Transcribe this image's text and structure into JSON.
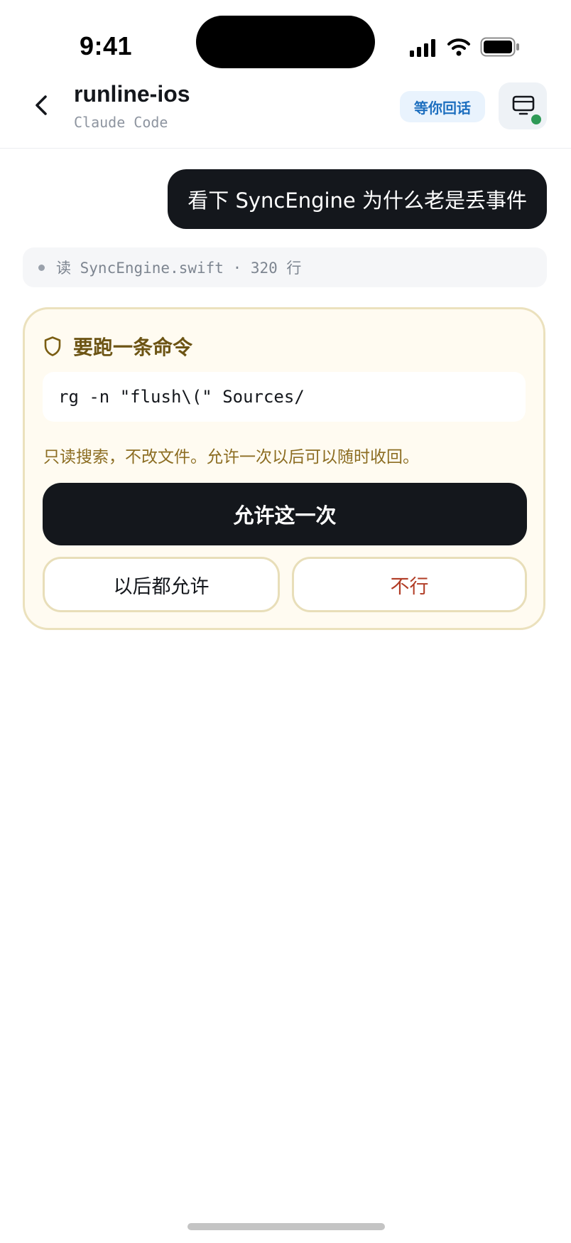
{
  "status_bar": {
    "time": "9:41",
    "icons": [
      "cellular-signal-icon",
      "wifi-icon",
      "battery-icon"
    ]
  },
  "header": {
    "back_icon": "chevron-left-icon",
    "title": "runline-ios",
    "subtitle": "Claude Code",
    "status_pill": "等你回话",
    "device_icon": "monitor-icon",
    "device_online": true
  },
  "conversation": {
    "user_message": "看下 SyncEngine 为什么老是丢事件",
    "tool_activity": "读 SyncEngine.swift · 320 行"
  },
  "permission_card": {
    "icon": "shield-icon",
    "title": "要跑一条命令",
    "command": "rg -n \"flush\\(\" Sources/",
    "note": "只读搜索，不改文件。允许一次以后可以随时收回。",
    "allow_once_label": "允许这一次",
    "allow_always_label": "以后都允许",
    "deny_label": "不行"
  },
  "colors": {
    "dark": "#14171c",
    "pill_bg": "#e9f3fd",
    "pill_text": "#1d6fbf",
    "card_bg": "#fffbf1",
    "card_border": "#ebe1bd",
    "card_title": "#6c5414",
    "card_note": "#8c6d22",
    "deny_text": "#b13c25",
    "online": "#2f9a57"
  }
}
